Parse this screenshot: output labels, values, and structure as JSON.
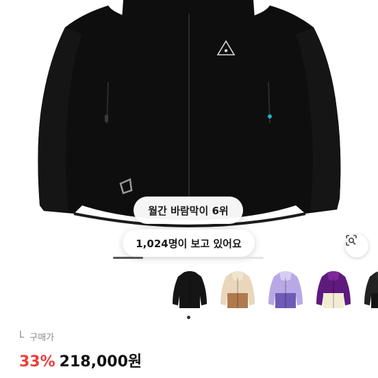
{
  "product": {
    "brand_logo": "acg-triangle-logo",
    "color": "#0e0e0e"
  },
  "badges": {
    "rank": "월간 바람막이 6위",
    "viewers": "1,024명이 보고 있어요"
  },
  "gallery": {
    "progress": 0.2
  },
  "icons": {
    "lens": "lens-search-icon"
  },
  "variants": [
    {
      "name": "black",
      "body": "#151515",
      "accent": "#151515",
      "lower": "#151515"
    },
    {
      "name": "beige-brown",
      "body": "#e9d6bb",
      "accent": "#efe4cf",
      "lower": "#b07a4f"
    },
    {
      "name": "lavender-purple",
      "body": "#b9a8e6",
      "accent": "#d7cdf2",
      "lower": "#6d5bb5"
    },
    {
      "name": "purple-cream",
      "body": "#5f1a7d",
      "accent": "#7b2a98",
      "lower": "#f2edd2"
    },
    {
      "name": "black-2",
      "body": "#222222",
      "accent": "#2a2a2a",
      "lower": "#151515"
    }
  ],
  "info": {
    "size": "L",
    "purchase_label": "구매가",
    "discount": "33%",
    "price": "218,000원"
  },
  "colors": {
    "discount": "#e8403b"
  }
}
